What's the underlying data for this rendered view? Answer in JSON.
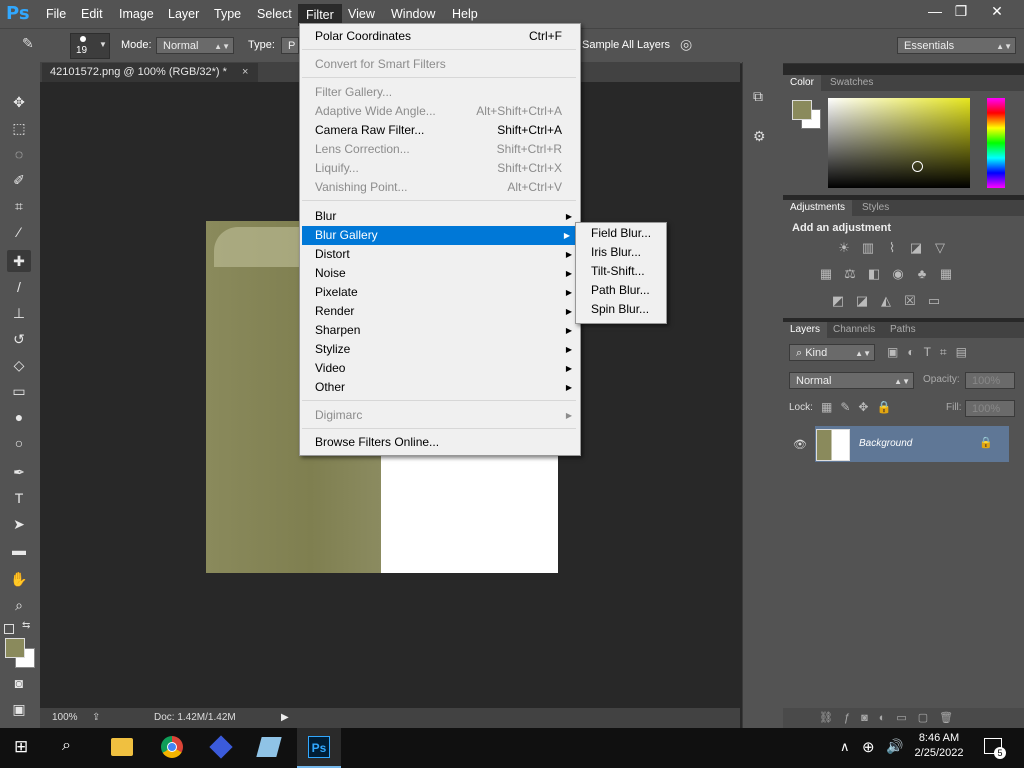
{
  "app": {
    "logo": "Ps"
  },
  "menubar": {
    "items": [
      "File",
      "Edit",
      "Image",
      "Layer",
      "Type",
      "Select",
      "Filter",
      "View",
      "Window",
      "Help"
    ],
    "active": "Filter",
    "win_minimize": "—",
    "win_restore": "❐",
    "win_close": "✕"
  },
  "options": {
    "brush_size": "19",
    "mode_label": "Mode:",
    "mode_value": "Normal",
    "type_label": "Type:",
    "type_value": "P",
    "sample_all_layers": "Sample All Layers",
    "workspace": "Essentials"
  },
  "document": {
    "tab_title": "42101572.png @ 100% (RGB/32*) *",
    "tab_close": "×"
  },
  "status": {
    "zoom": "100%",
    "doc": "Doc: 1.42M/1.42M"
  },
  "filter_menu": {
    "last_filter": {
      "label": "Polar Coordinates",
      "shortcut": "Ctrl+F"
    },
    "convert_smart": "Convert for Smart Filters",
    "group1": [
      {
        "label": "Filter Gallery...",
        "shortcut": "",
        "disabled": true
      },
      {
        "label": "Adaptive Wide Angle...",
        "shortcut": "Alt+Shift+Ctrl+A",
        "disabled": true
      },
      {
        "label": "Camera Raw Filter...",
        "shortcut": "Shift+Ctrl+A",
        "disabled": false
      },
      {
        "label": "Lens Correction...",
        "shortcut": "Shift+Ctrl+R",
        "disabled": true
      },
      {
        "label": "Liquify...",
        "shortcut": "Shift+Ctrl+X",
        "disabled": true
      },
      {
        "label": "Vanishing Point...",
        "shortcut": "Alt+Ctrl+V",
        "disabled": true
      }
    ],
    "group2": [
      "Blur",
      "Blur Gallery",
      "Distort",
      "Noise",
      "Pixelate",
      "Render",
      "Sharpen",
      "Stylize",
      "Video",
      "Other"
    ],
    "highlighted": "Blur Gallery",
    "digimarc": "Digimarc",
    "browse": "Browse Filters Online..."
  },
  "blur_gallery_submenu": [
    "Field Blur...",
    "Iris Blur...",
    "Tilt-Shift...",
    "Path Blur...",
    "Spin Blur..."
  ],
  "panels": {
    "color_tabs": [
      "Color",
      "Swatches"
    ],
    "adjust_tabs": [
      "Adjustments",
      "Styles"
    ],
    "adjust_heading": "Add an adjustment",
    "layers_tabs": [
      "Layers",
      "Channels",
      "Paths"
    ],
    "kind": "Kind",
    "blend": "Normal",
    "opacity_label": "Opacity:",
    "opacity_value": "100%",
    "lock_label": "Lock:",
    "fill_label": "Fill:",
    "fill_value": "100%",
    "layer_name": "Background"
  },
  "colors": {
    "foreground": "#8a8a5c",
    "background": "#ffffff",
    "highlight": "#0078d7"
  },
  "taskbar": {
    "time": "8:46 AM",
    "date": "2/25/2022",
    "notifications": "5"
  }
}
